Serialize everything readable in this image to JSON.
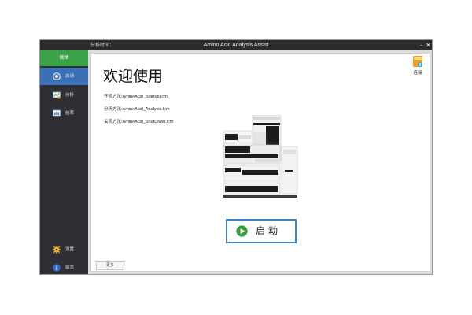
{
  "titlebar": {
    "left_text": "分析时间：",
    "title": "Amino Acid Analysis Assist",
    "minimize": "–",
    "close": "✕"
  },
  "sidebar": {
    "status": "就绪",
    "items": [
      {
        "label": "启动",
        "icon": "play-circle-icon",
        "active": true
      },
      {
        "label": "分析",
        "icon": "analysis-chart-icon",
        "active": false
      },
      {
        "label": "结果",
        "icon": "results-icon",
        "active": false
      }
    ],
    "bottom_items": [
      {
        "label": "设置",
        "icon": "gear-icon"
      },
      {
        "label": "版本",
        "icon": "info-icon"
      }
    ]
  },
  "main": {
    "welcome": "欢迎使用",
    "methods": [
      "开机方法:AminoAcid_Startup.lcm",
      "分析方法:AminoAcid_Analysis.lcm",
      "关机方法:AminoAcid_ShutDown.lcm"
    ],
    "connect_label": "连接",
    "start_label": "启动",
    "more_label": "更多"
  },
  "colors": {
    "status_green": "#3aa34a",
    "active_blue": "#3b6fb6",
    "sidebar_bg": "#2f2f36",
    "titlebar_bg": "#2b2b2b",
    "start_border": "#3d84c8",
    "play_green": "#3a9a3e"
  }
}
